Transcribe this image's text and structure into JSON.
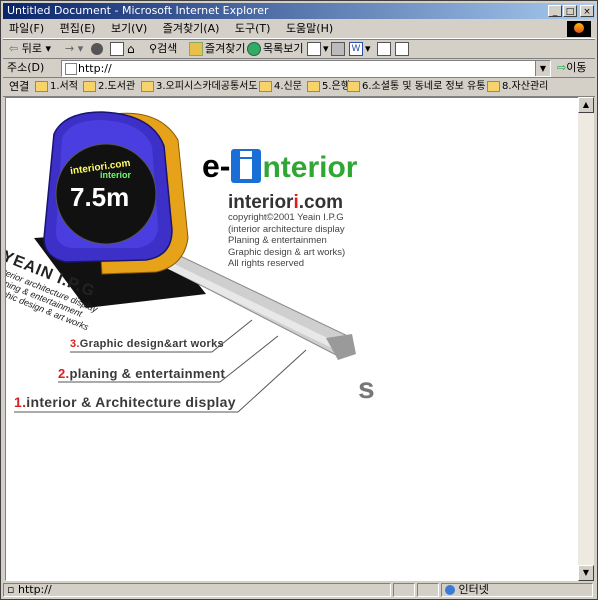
{
  "window": {
    "title": "Untitled Document - Microsoft Internet Explorer",
    "min": "_",
    "max": "□",
    "close": "×"
  },
  "menu": [
    "파일(F)",
    "편집(E)",
    "보기(V)",
    "즐겨찾기(A)",
    "도구(T)",
    "도움말(H)"
  ],
  "toolbar": {
    "back": "뒤로",
    "forward": "→",
    "search": "검색",
    "favorites": "즐겨찾기",
    "history": "목록보기"
  },
  "address": {
    "label": "주소(D)",
    "value": "http://",
    "go": "이동"
  },
  "links": {
    "label": "연결",
    "items": [
      "1.서적",
      "2.도서관",
      "3.오피시스카데공통서도",
      "4.신문",
      "5.은행",
      "6.소셜통 및 동네로 정보 유통",
      "8.자산관리"
    ]
  },
  "page": {
    "brand_e": "e-",
    "brand_interior": "nterior",
    "domain_a": "interior",
    "domain_b": "i",
    "domain_c": ".com",
    "credits": [
      "copyright©2001 Yeain I.P.G",
      "(interior architecture display",
      "Planing & entertainmen",
      "Graphic design & art works)",
      "All rights reserved"
    ],
    "tape_brand": "interiori.com",
    "tape_size": "7.5m",
    "tape_logo": "interior",
    "yeain_title": "YEAIN I.P.G",
    "yeain_lines": [
      "interior architecture display",
      "planing & entertainment",
      "graphic design & art works"
    ],
    "menu_items": [
      {
        "num": "3.",
        "label": "Graphic design&art works"
      },
      {
        "num": "2.",
        "label": "planing & entertainment"
      },
      {
        "num": "1.",
        "label": "interior & Architecture display"
      }
    ],
    "fragment": "s"
  },
  "status": {
    "text": "http://",
    "zone": "인터넷"
  }
}
